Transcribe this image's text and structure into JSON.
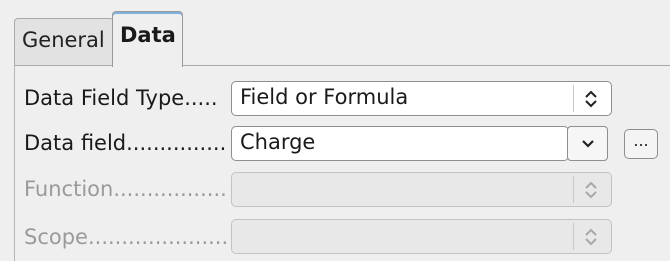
{
  "tabs": [
    {
      "label": "General",
      "active": false
    },
    {
      "label": "Data",
      "active": true
    }
  ],
  "form": {
    "data_field_type": {
      "label": "Data Field Type.....",
      "value": "Field or Formula"
    },
    "data_field": {
      "label": "Data field...............",
      "value": "Charge",
      "more_label": "..."
    },
    "function": {
      "label": "Function..................",
      "value": ""
    },
    "scope": {
      "label": "Scope.......................",
      "value": ""
    }
  },
  "icons": {
    "spin": "up-down-arrows-icon",
    "dropdown": "chevron-down-icon"
  }
}
